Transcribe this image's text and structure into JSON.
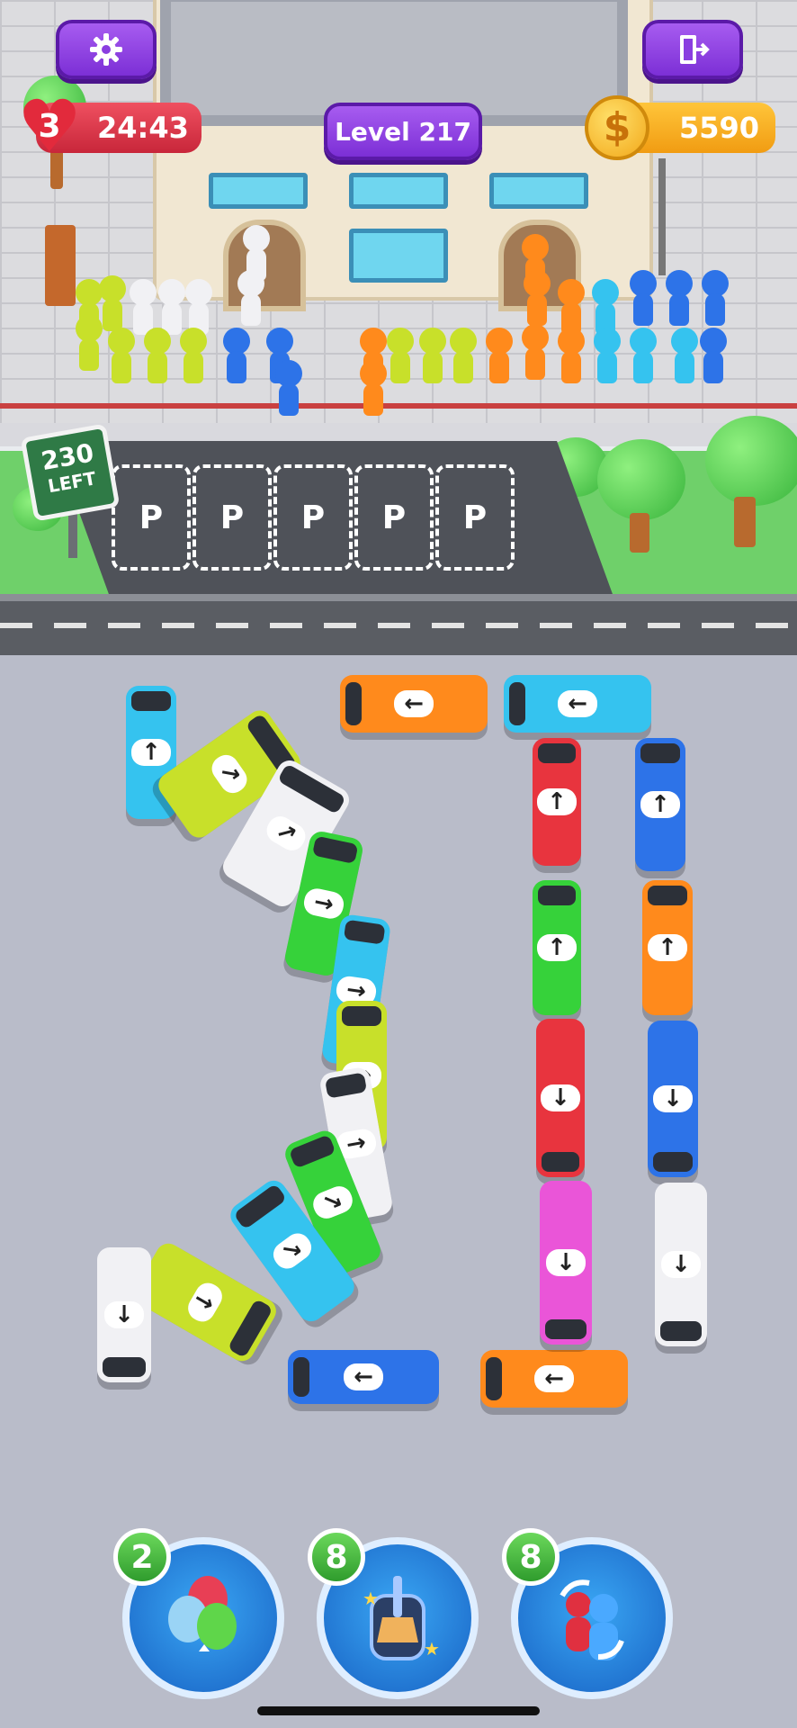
{
  "hud": {
    "lives": "3",
    "timer": "24:43",
    "level_label": "Level 217",
    "coins": "5590",
    "coin_symbol": "$"
  },
  "scene": {
    "sign_count": "230",
    "sign_label": "LEFT",
    "parking_label": "P"
  },
  "boosters": [
    {
      "name": "balloons",
      "count": "2"
    },
    {
      "name": "broom-cleaner",
      "count": "8"
    },
    {
      "name": "swap-passengers",
      "count": "8"
    }
  ],
  "colors": {
    "cyan": "#35c3ef",
    "yellow": "#c8e02a",
    "white": "#f1f1f4",
    "green": "#36d23a",
    "red": "#e8343e",
    "blue": "#2d73e8",
    "orange": "#ff8a1c",
    "pink": "#ea55d8"
  },
  "buses": [
    {
      "color": "cyan",
      "dir": "up"
    },
    {
      "color": "yellow",
      "dir": "up-right"
    },
    {
      "color": "white",
      "dir": "up-right"
    },
    {
      "color": "green",
      "dir": "right"
    },
    {
      "color": "cyan",
      "dir": "right"
    },
    {
      "color": "yellow",
      "dir": "right"
    },
    {
      "color": "white",
      "dir": "right"
    },
    {
      "color": "green",
      "dir": "down-right"
    },
    {
      "color": "cyan",
      "dir": "down-right"
    },
    {
      "color": "yellow",
      "dir": "down"
    },
    {
      "color": "white",
      "dir": "down"
    },
    {
      "color": "blue",
      "dir": "left"
    },
    {
      "color": "orange",
      "dir": "left"
    },
    {
      "color": "orange",
      "dir": "left"
    },
    {
      "color": "cyan",
      "dir": "left"
    },
    {
      "color": "red",
      "dir": "up"
    },
    {
      "color": "blue",
      "dir": "up"
    },
    {
      "color": "green",
      "dir": "up"
    },
    {
      "color": "orange",
      "dir": "up"
    },
    {
      "color": "red",
      "dir": "down"
    },
    {
      "color": "blue",
      "dir": "down"
    },
    {
      "color": "pink",
      "dir": "down"
    },
    {
      "color": "white",
      "dir": "down"
    }
  ]
}
